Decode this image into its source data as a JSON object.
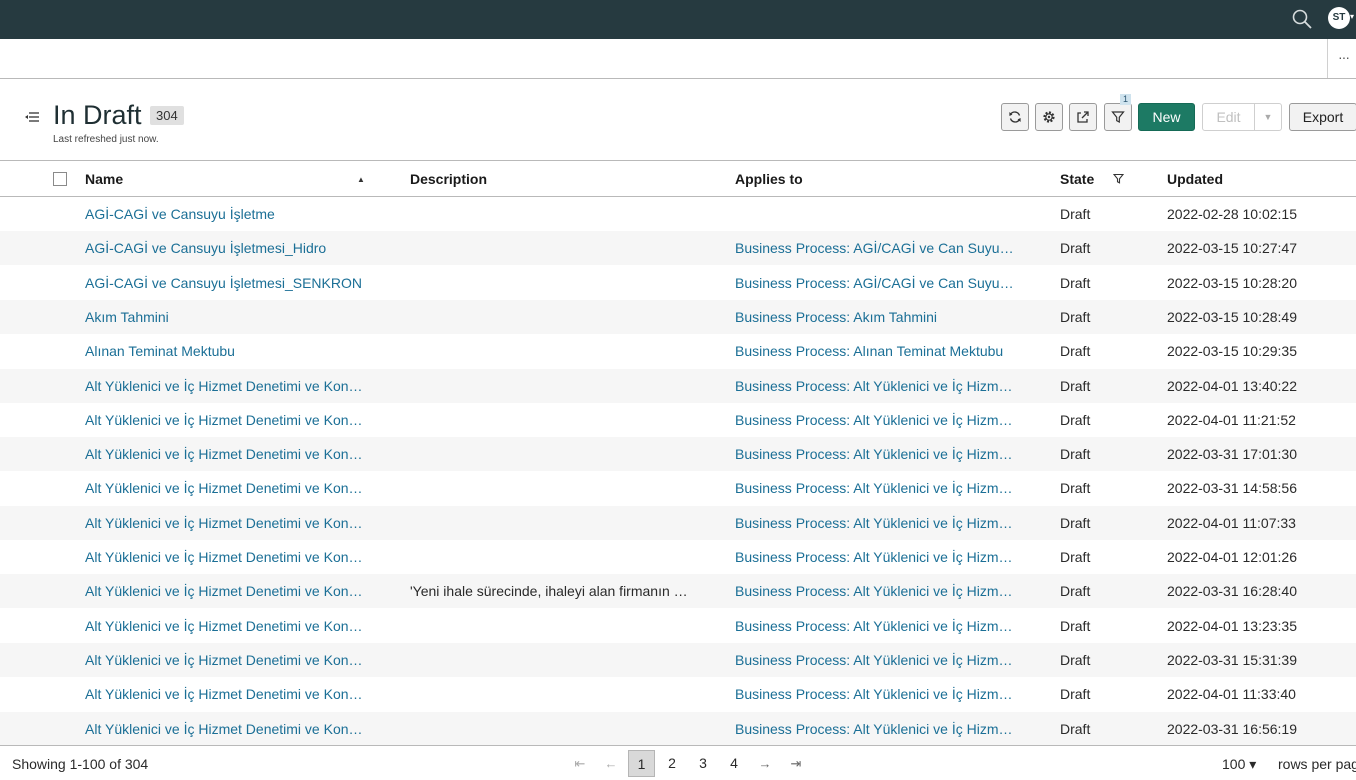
{
  "topbar": {
    "avatar_initials": "ST"
  },
  "tabstrip": {
    "more_label": "···"
  },
  "header": {
    "title": "In Draft",
    "count": "304",
    "refresh_note": "Last refreshed just now.",
    "filter_count": "1",
    "new_label": "New",
    "edit_label": "Edit",
    "export_label": "Export"
  },
  "table": {
    "columns": {
      "name": "Name",
      "description": "Description",
      "applies_to": "Applies to",
      "state": "State",
      "updated": "Updated"
    },
    "rows": [
      {
        "name": "AGİ-CAGİ ve Cansuyu İşletme",
        "description": "",
        "applies_to": "",
        "state": "Draft",
        "updated": "2022-02-28 10:02:15"
      },
      {
        "name": "AGİ-CAGİ ve Cansuyu İşletmesi_Hidro",
        "description": "",
        "applies_to": "Business Process: AGİ/CAGİ ve Can Suyu İşletmesi",
        "state": "Draft",
        "updated": "2022-03-15 10:27:47"
      },
      {
        "name": "AGİ-CAGİ ve Cansuyu İşletmesi_SENKRON",
        "description": "",
        "applies_to": "Business Process: AGİ/CAGİ ve Can Suyu İşletmesi",
        "state": "Draft",
        "updated": "2022-03-15 10:28:20"
      },
      {
        "name": "Akım Tahmini",
        "description": "",
        "applies_to": "Business Process: Akım Tahmini",
        "state": "Draft",
        "updated": "2022-03-15 10:28:49"
      },
      {
        "name": "Alınan Teminat Mektubu",
        "description": "",
        "applies_to": "Business Process: Alınan Teminat Mektubu",
        "state": "Draft",
        "updated": "2022-03-15 10:29:35"
      },
      {
        "name": "Alt Yüklenici ve İç Hizmet Denetimi ve Kontrolü",
        "description": "",
        "applies_to": "Business Process: Alt Yüklenici ve İç Hizmet Denetimi",
        "state": "Draft",
        "updated": "2022-04-01 13:40:22"
      },
      {
        "name": "Alt Yüklenici ve İç Hizmet Denetimi ve Kontrolü",
        "description": "",
        "applies_to": "Business Process: Alt Yüklenici ve İç Hizmet Denetimi",
        "state": "Draft",
        "updated": "2022-04-01 11:21:52"
      },
      {
        "name": "Alt Yüklenici ve İç Hizmet Denetimi ve Kontrolü",
        "description": "",
        "applies_to": "Business Process: Alt Yüklenici ve İç Hizmet Denetimi",
        "state": "Draft",
        "updated": "2022-03-31 17:01:30"
      },
      {
        "name": "Alt Yüklenici ve İç Hizmet Denetimi ve Kontrolü",
        "description": "",
        "applies_to": "Business Process: Alt Yüklenici ve İç Hizmet Denetimi",
        "state": "Draft",
        "updated": "2022-03-31 14:58:56"
      },
      {
        "name": "Alt Yüklenici ve İç Hizmet Denetimi ve Kontrolü",
        "description": "",
        "applies_to": "Business Process: Alt Yüklenici ve İç Hizmet Denetimi",
        "state": "Draft",
        "updated": "2022-04-01 11:07:33"
      },
      {
        "name": "Alt Yüklenici ve İç Hizmet Denetimi ve Kontrolü",
        "description": "",
        "applies_to": "Business Process: Alt Yüklenici ve İç Hizmet Denetimi",
        "state": "Draft",
        "updated": "2022-04-01 12:01:26"
      },
      {
        "name": "Alt Yüklenici ve İç Hizmet Denetimi ve Kontrolü",
        "description": "'Yeni ihale sürecinde, ihaleyi alan firmanın şartnameye",
        "applies_to": "Business Process: Alt Yüklenici ve İç Hizmet Denetimi",
        "state": "Draft",
        "updated": "2022-03-31 16:28:40"
      },
      {
        "name": "Alt Yüklenici ve İç Hizmet Denetimi ve Kontrolü",
        "description": "",
        "applies_to": "Business Process: Alt Yüklenici ve İç Hizmet Denetimi",
        "state": "Draft",
        "updated": "2022-04-01 13:23:35"
      },
      {
        "name": "Alt Yüklenici ve İç Hizmet Denetimi ve Kontrolü",
        "description": "",
        "applies_to": "Business Process: Alt Yüklenici ve İç Hizmet Denetimi",
        "state": "Draft",
        "updated": "2022-03-31 15:31:39"
      },
      {
        "name": "Alt Yüklenici ve İç Hizmet Denetimi ve Kontrolü",
        "description": "",
        "applies_to": "Business Process: Alt Yüklenici ve İç Hizmet Denetimi",
        "state": "Draft",
        "updated": "2022-04-01 11:33:40"
      },
      {
        "name": "Alt Yüklenici ve İç Hizmet Denetimi ve Kontrolü",
        "description": "",
        "applies_to": "Business Process: Alt Yüklenici ve İç Hizmet Denetimi",
        "state": "Draft",
        "updated": "2022-03-31 16:56:19"
      }
    ]
  },
  "footer": {
    "showing": "Showing 1-100 of 304",
    "first_icon": "⇤",
    "prev_icon": "←",
    "pages": [
      "1",
      "2",
      "3",
      "4"
    ],
    "next_icon": "→",
    "last_icon": "⇥",
    "rows_per_page_value": "100 ▾",
    "rows_per_page_label": "rows per page"
  }
}
